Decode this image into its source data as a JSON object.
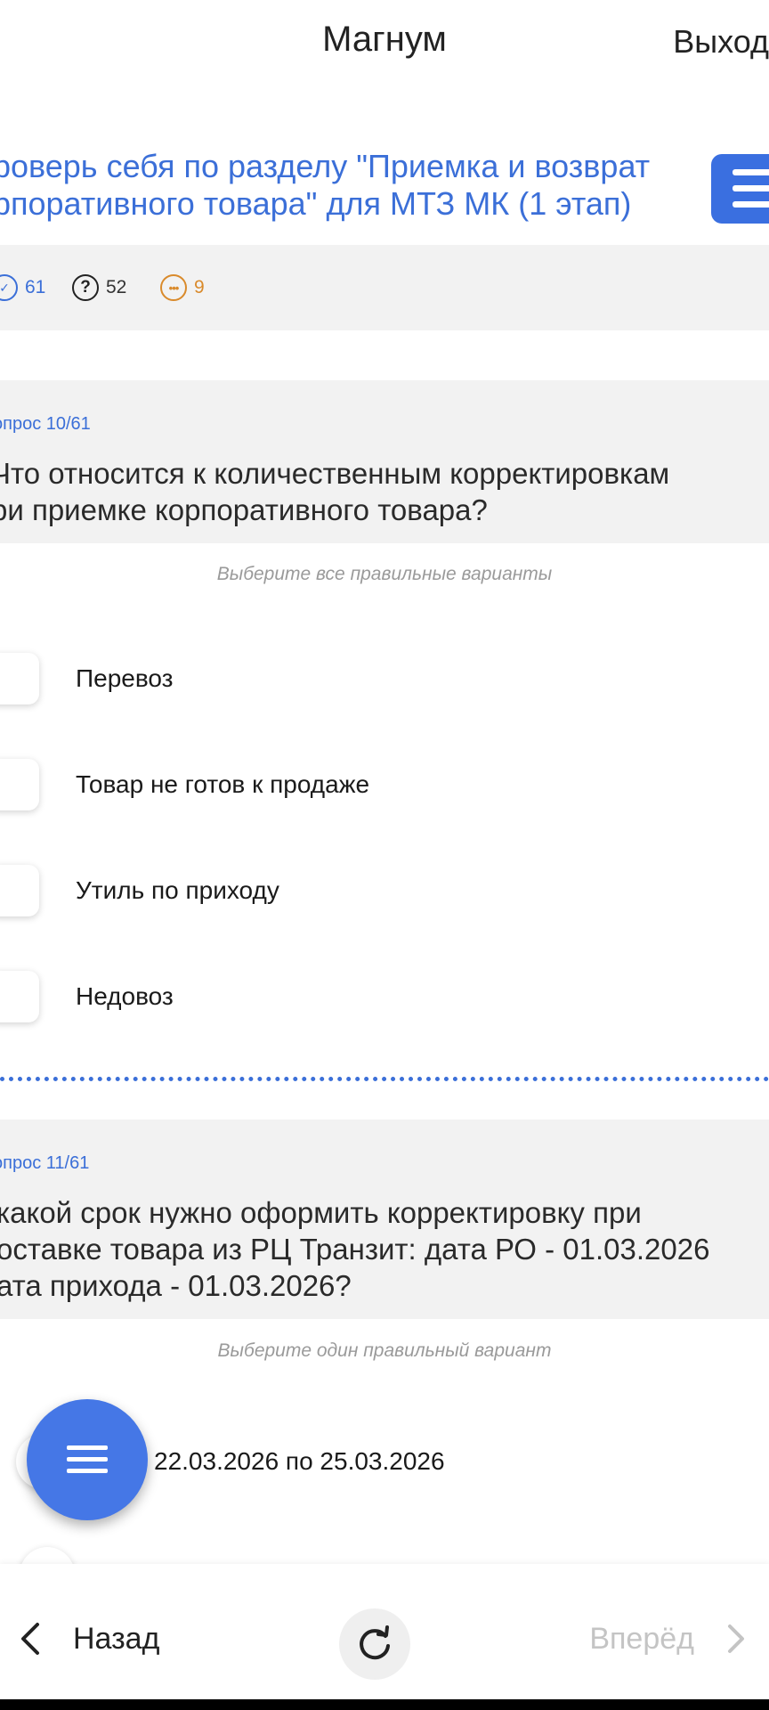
{
  "header": {
    "title": "Магнум",
    "logout_label": "Выход"
  },
  "test": {
    "title_line1": "роверь себя по разделу \"Приемка и возврат",
    "title_line2": "рпоративного товара\" для МТЗ МК (1 этап)"
  },
  "stats": {
    "total": "61",
    "unanswered": "52",
    "answered": "9"
  },
  "question10": {
    "number": "опрос 10/61",
    "text_line1": "Что относится к количественным корректировкам",
    "text_line2": "ри приемке корпоративного товара?",
    "hint": "Выберите все правильные варианты",
    "options": [
      "Перевоз",
      "Товар не готов к продаже",
      "Утиль по приходу",
      "Недовоз"
    ]
  },
  "question11": {
    "number": "опрос 11/61",
    "text_line1": " какой срок нужно оформить корректировку при",
    "text_line2": "оставке товара из РЦ Транзит: дата РО - 01.03.2026",
    "text_line3": "ата прихода - 01.03.2026?",
    "hint": "Выберите один правильный вариант",
    "options": [
      "22.03.2026 по 25.03.2026"
    ]
  },
  "nav": {
    "back_label": "Назад",
    "forward_label": "Вперёд"
  },
  "colors": {
    "accent": "#3b6fd8",
    "fab": "#4577e6",
    "stat_answered": "#d98a2b"
  },
  "icons": {
    "total": "check-circle-icon",
    "unanswered": "question-circle-icon",
    "answered": "dots-circle-icon",
    "back": "chevron-left-icon",
    "forward": "chevron-right-icon",
    "refresh": "refresh-icon",
    "menu": "hamburger-icon"
  }
}
